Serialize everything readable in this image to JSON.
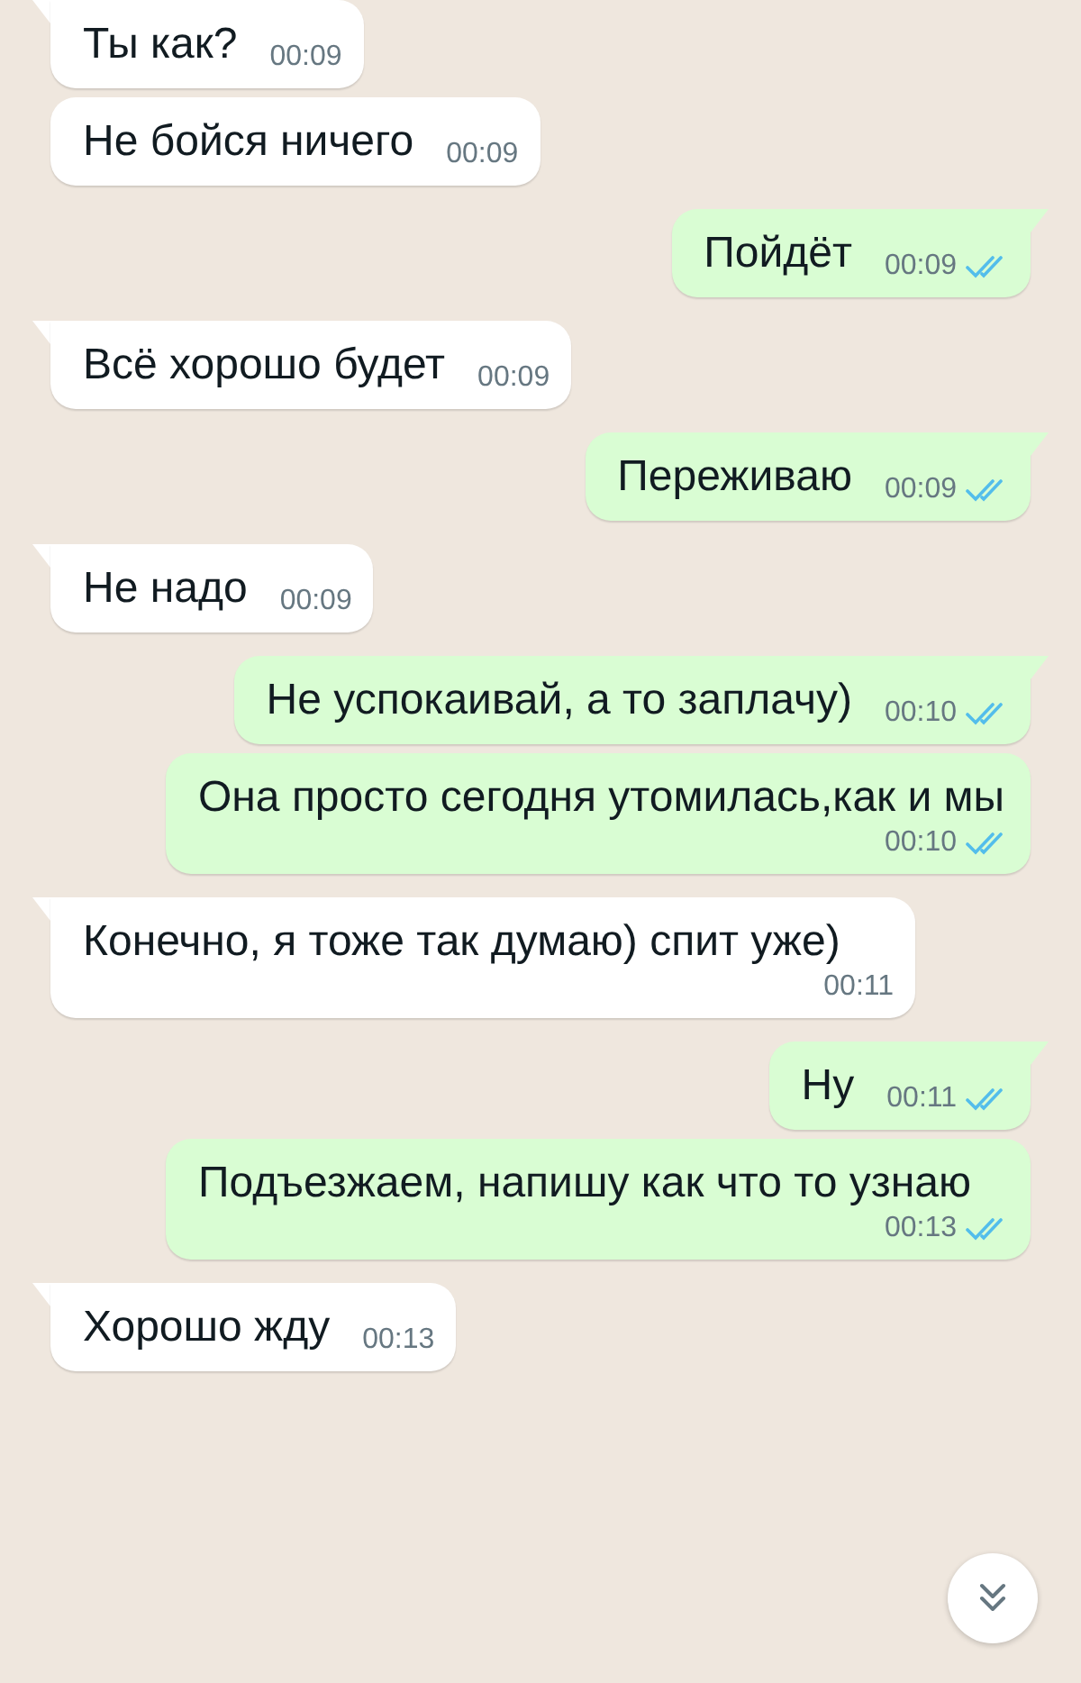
{
  "messages": [
    {
      "kind": "incoming",
      "text": "Ты как?",
      "time": "00:09",
      "tail": true
    },
    {
      "kind": "incoming",
      "text": "Не бойся ничего",
      "time": "00:09",
      "tail": false
    },
    {
      "kind": "outgoing",
      "text": "Пойдёт",
      "time": "00:09",
      "tail": true,
      "read": true
    },
    {
      "kind": "incoming",
      "text": "Всё хорошо будет",
      "time": "00:09",
      "tail": true
    },
    {
      "kind": "outgoing",
      "text": "Переживаю",
      "time": "00:09",
      "tail": true,
      "read": true
    },
    {
      "kind": "incoming",
      "text": "Не надо",
      "time": "00:09",
      "tail": true
    },
    {
      "kind": "outgoing",
      "text": "Не успокаивай, а то заплачу)",
      "time": "00:10",
      "tail": true,
      "read": true
    },
    {
      "kind": "outgoing",
      "text": "Она просто сегодня утомилась,как и мы",
      "time": "00:10",
      "tail": false,
      "read": true
    },
    {
      "kind": "incoming",
      "text": "Конечно, я тоже так думаю) спит уже)",
      "time": "00:11",
      "tail": true
    },
    {
      "kind": "outgoing",
      "text": "Ну",
      "time": "00:11",
      "tail": true,
      "read": true
    },
    {
      "kind": "outgoing",
      "text": "Подъезжаем, напишу как что то узнаю",
      "time": "00:13",
      "tail": false,
      "read": true
    },
    {
      "kind": "incoming",
      "text": "Хорошо жду",
      "time": "00:13",
      "tail": true
    }
  ],
  "scroll_button": {
    "visible": true
  }
}
